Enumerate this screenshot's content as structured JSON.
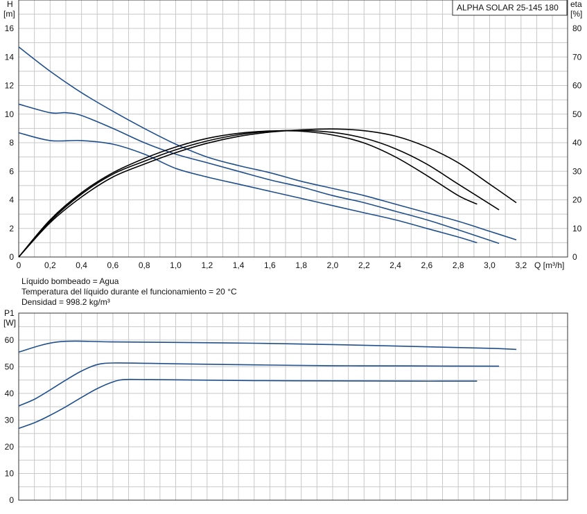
{
  "title_box": "ALPHA SOLAR 25-145  180",
  "info_lines": [
    "Líquido bombeado = Agua",
    "Temperatura del líquido durante el funcionamiento = 20 °C",
    "Densidad = 998.2 kg/m³"
  ],
  "colors": {
    "head_curves": "#1f4e8c",
    "efficiency_curves": "#000000",
    "power_curves": "#1f4e8c",
    "grid": "#c8c8c8"
  },
  "chart_data": [
    {
      "type": "line",
      "title": "ALPHA SOLAR 25-145  180",
      "xlabel": "Q [m³/h]",
      "ylabel": "H [m]",
      "y2label": "eta [%]",
      "xlim": [
        0,
        3.2
      ],
      "ylim": [
        0,
        16
      ],
      "y2lim": [
        0,
        80
      ],
      "x_ticks": [
        "0",
        "0,2",
        "0,4",
        "0,6",
        "0,8",
        "1,0",
        "1,2",
        "1,4",
        "1,6",
        "1,8",
        "2,0",
        "2,2",
        "2,4",
        "2,6",
        "2,8",
        "3,0",
        "3,2"
      ],
      "y_ticks": [
        "0",
        "2",
        "4",
        "6",
        "8",
        "10",
        "12",
        "14",
        "16"
      ],
      "y2_ticks": [
        "0",
        "10",
        "20",
        "30",
        "40",
        "50",
        "60",
        "70",
        "80"
      ],
      "grid": true,
      "series": [
        {
          "axis": "left",
          "color": "#1f4e8c",
          "x": [
            0,
            0.2,
            0.4,
            0.6,
            0.8,
            1.0,
            1.2,
            1.4,
            1.6,
            1.8,
            2.0,
            2.2,
            2.4,
            2.6,
            2.8,
            3.0,
            3.17
          ],
          "y": [
            14.7,
            13.0,
            11.5,
            10.2,
            9.0,
            7.9,
            7.0,
            6.4,
            5.9,
            5.3,
            4.8,
            4.3,
            3.7,
            3.1,
            2.5,
            1.8,
            1.2
          ]
        },
        {
          "axis": "left",
          "color": "#1f4e8c",
          "x": [
            0,
            0.2,
            0.3,
            0.4,
            0.6,
            0.8,
            1.0,
            1.2,
            1.4,
            1.6,
            1.8,
            2.0,
            2.2,
            2.4,
            2.6,
            2.8,
            3.06
          ],
          "y": [
            10.7,
            10.1,
            10.1,
            9.9,
            9.0,
            8.0,
            7.2,
            6.6,
            6.0,
            5.4,
            4.9,
            4.3,
            3.8,
            3.2,
            2.6,
            1.9,
            0.95
          ]
        },
        {
          "axis": "left",
          "color": "#1f4e8c",
          "x": [
            0,
            0.2,
            0.4,
            0.6,
            0.8,
            1.0,
            1.2,
            1.4,
            1.6,
            1.8,
            2.0,
            2.2,
            2.4,
            2.6,
            2.8,
            2.92
          ],
          "y": [
            8.7,
            8.15,
            8.15,
            7.9,
            7.2,
            6.2,
            5.6,
            5.1,
            4.6,
            4.1,
            3.6,
            3.1,
            2.6,
            2.0,
            1.4,
            1.0
          ]
        },
        {
          "axis": "right",
          "color": "#000000",
          "x": [
            0,
            0.2,
            0.4,
            0.6,
            0.8,
            1.0,
            1.2,
            1.4,
            1.6,
            1.8,
            2.0,
            2.2,
            2.4,
            2.6,
            2.8,
            3.0,
            3.17
          ],
          "y": [
            0,
            12,
            21,
            28,
            32.5,
            36.5,
            39.8,
            42.2,
            43.7,
            44.5,
            44.8,
            44.2,
            42.3,
            38.5,
            33.0,
            25.5,
            19.0
          ]
        },
        {
          "axis": "right",
          "color": "#000000",
          "x": [
            0,
            0.2,
            0.4,
            0.6,
            0.8,
            1.0,
            1.2,
            1.4,
            1.6,
            1.8,
            2.0,
            2.2,
            2.4,
            2.6,
            2.8,
            3.06
          ],
          "y": [
            0,
            12.5,
            22,
            29,
            33.5,
            37.5,
            40.6,
            42.8,
            44.0,
            44.3,
            43.6,
            41.6,
            37.9,
            32.5,
            25.5,
            16.5
          ]
        },
        {
          "axis": "right",
          "color": "#000000",
          "x": [
            0,
            0.2,
            0.4,
            0.6,
            0.8,
            1.0,
            1.2,
            1.4,
            1.6,
            1.8,
            2.0,
            2.2,
            2.4,
            2.6,
            2.8,
            2.92
          ],
          "y": [
            0,
            13,
            22.5,
            29.5,
            34.5,
            38.5,
            41.5,
            43.3,
            44.1,
            44.0,
            42.7,
            39.9,
            35.0,
            28.5,
            21.5,
            18.5
          ]
        }
      ]
    },
    {
      "type": "line",
      "title": "",
      "xlabel": "",
      "ylabel": "P1 [W]",
      "xlim": [
        0,
        3.5
      ],
      "ylim": [
        0,
        65
      ],
      "y_ticks": [
        "0",
        "10",
        "20",
        "30",
        "40",
        "50",
        "60"
      ],
      "grid": true,
      "series": [
        {
          "color": "#1f4e8c",
          "x": [
            0,
            0.25,
            0.6,
            1.0,
            1.5,
            2.0,
            2.5,
            3.0,
            3.17
          ],
          "y": [
            55.5,
            59.3,
            59.3,
            59.1,
            58.8,
            58.3,
            57.6,
            56.9,
            56.5
          ]
        },
        {
          "color": "#1f4e8c",
          "x": [
            0,
            0.1,
            0.2,
            0.3,
            0.4,
            0.5,
            0.6,
            0.8,
            1.0,
            1.5,
            2.0,
            2.5,
            3.06
          ],
          "y": [
            35.3,
            37.8,
            41.3,
            45.0,
            48.4,
            50.8,
            51.4,
            51.3,
            51.1,
            50.7,
            50.4,
            50.3,
            50.2
          ]
        },
        {
          "color": "#1f4e8c",
          "x": [
            0,
            0.1,
            0.2,
            0.3,
            0.4,
            0.5,
            0.6,
            0.67,
            0.8,
            1.0,
            1.5,
            2.0,
            2.5,
            2.92
          ],
          "y": [
            26.9,
            29.0,
            31.8,
            35.0,
            38.5,
            41.8,
            44.3,
            45.2,
            45.2,
            45.1,
            44.8,
            44.7,
            44.6,
            44.6
          ]
        }
      ]
    }
  ],
  "axes_text": {
    "top_ylabel_name": "H",
    "top_ylabel_unit": "[m]",
    "top_y2label_name": "eta",
    "top_y2label_unit": "[%]",
    "top_xlabel": "Q [m³/h]",
    "bottom_ylabel_name": "P1",
    "bottom_ylabel_unit": "[W]"
  }
}
